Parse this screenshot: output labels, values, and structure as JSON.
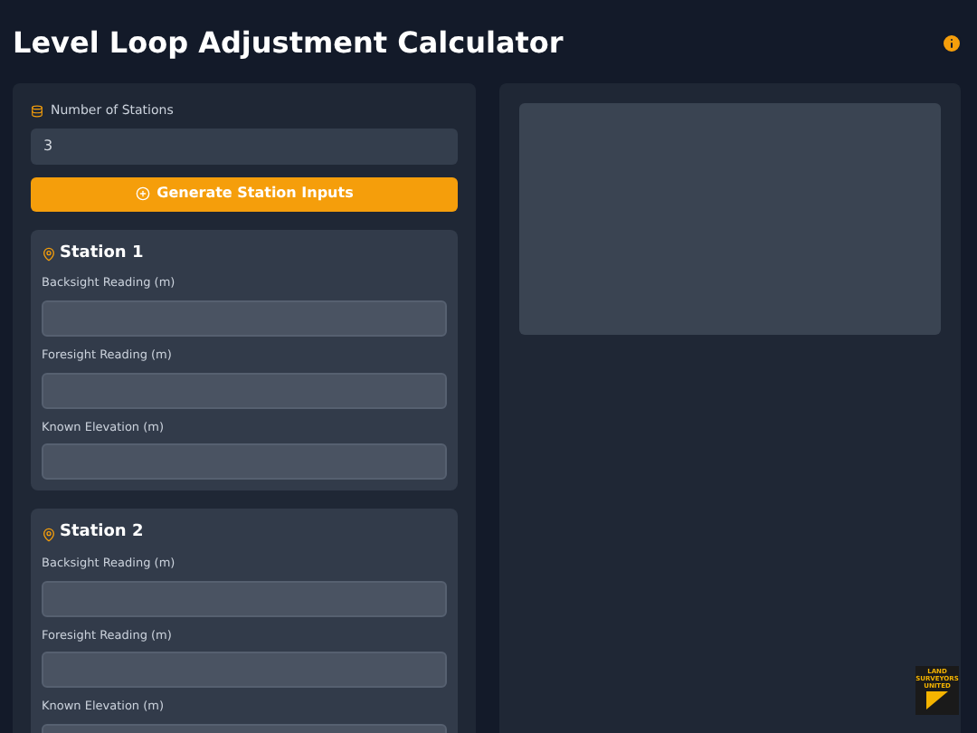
{
  "header": {
    "title": "Level Loop Adjustment Calculator"
  },
  "setup": {
    "label": "Number of Stations",
    "value": "3",
    "button": "Generate Station Inputs"
  },
  "stations": [
    {
      "title": "Station 1",
      "fields": [
        {
          "label": "Backsight Reading (m)"
        },
        {
          "label": "Foresight Reading (m)"
        },
        {
          "label": "Known Elevation (m)"
        }
      ]
    },
    {
      "title": "Station 2",
      "fields": [
        {
          "label": "Backsight Reading (m)"
        },
        {
          "label": "Foresight Reading (m)"
        },
        {
          "label": "Known Elevation (m)"
        }
      ]
    }
  ],
  "logo": {
    "lines": [
      "LAND",
      "SURVEYORS",
      "UNITED"
    ]
  }
}
